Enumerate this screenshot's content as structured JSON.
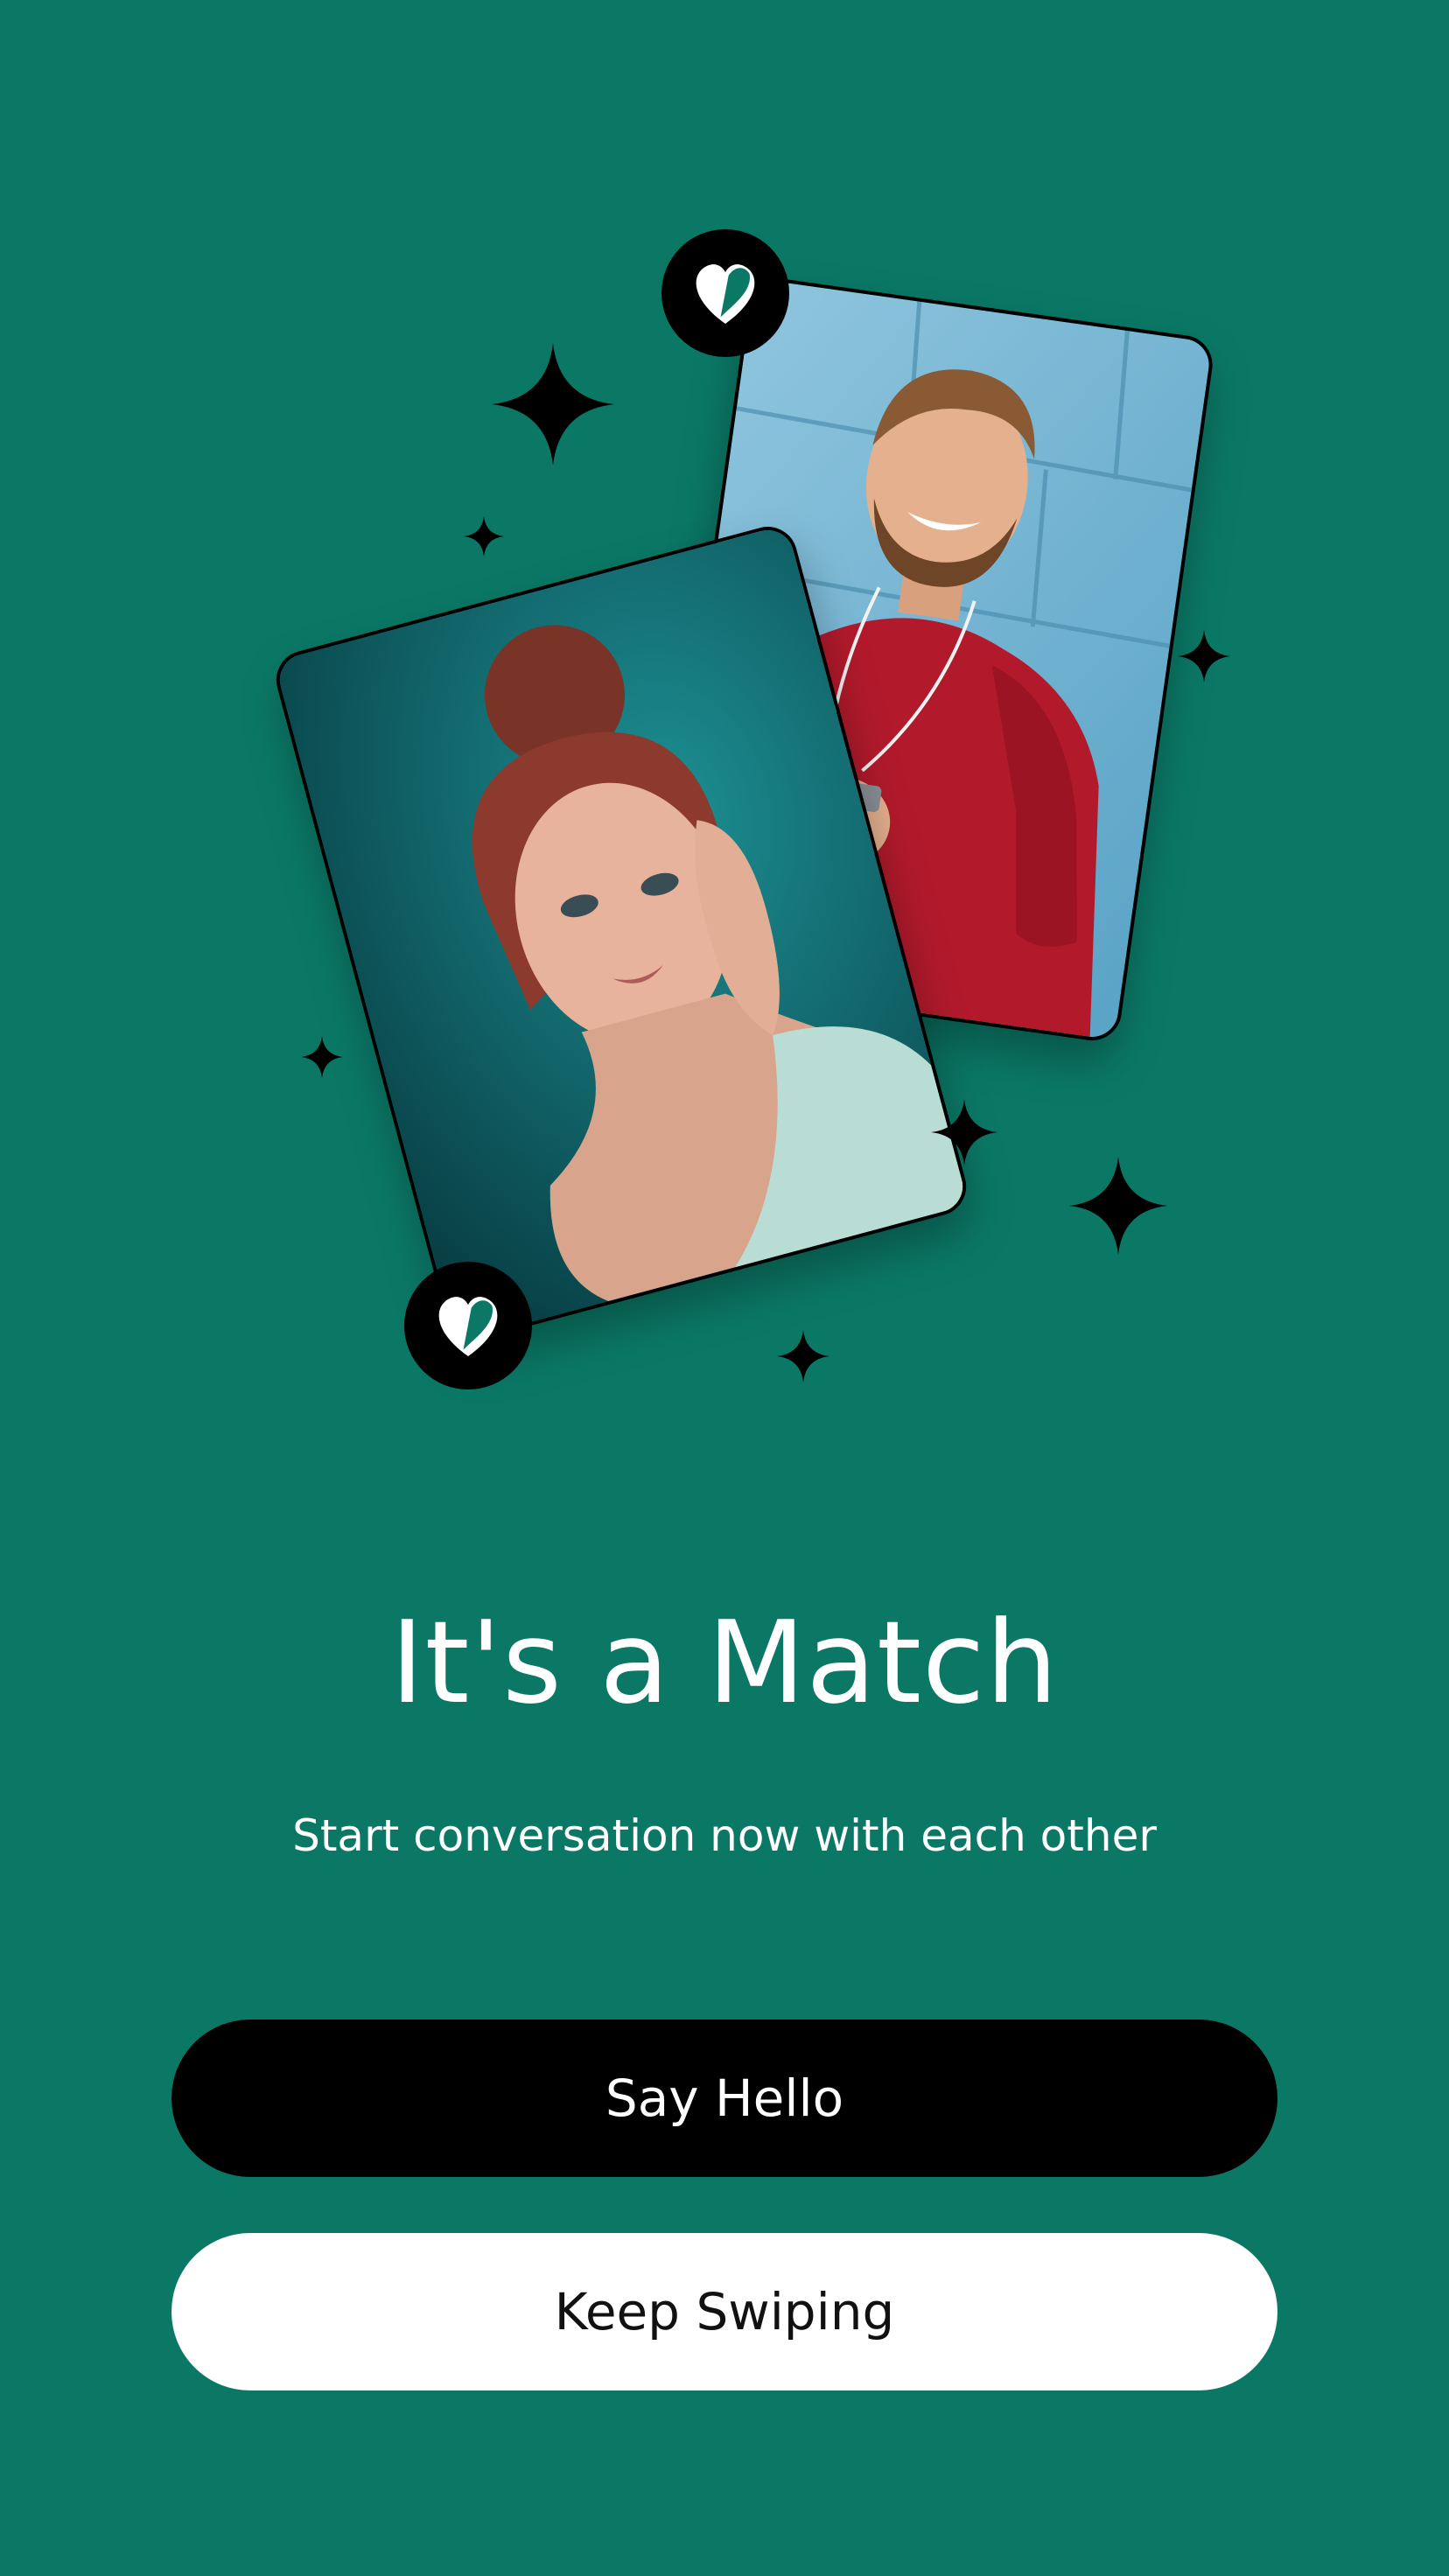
{
  "theme": {
    "background": "#0b7866",
    "primary_button_bg": "#000000",
    "secondary_button_bg": "#ffffff",
    "accent_heart": "#0b7866"
  },
  "match": {
    "title": "It's a Match",
    "subtitle": "Start conversation now with each other"
  },
  "actions": {
    "say_hello_label": "Say Hello",
    "keep_swiping_label": "Keep Swiping"
  },
  "icons": {
    "badge": "heart-icon",
    "decoration": "sparkle-icon"
  }
}
